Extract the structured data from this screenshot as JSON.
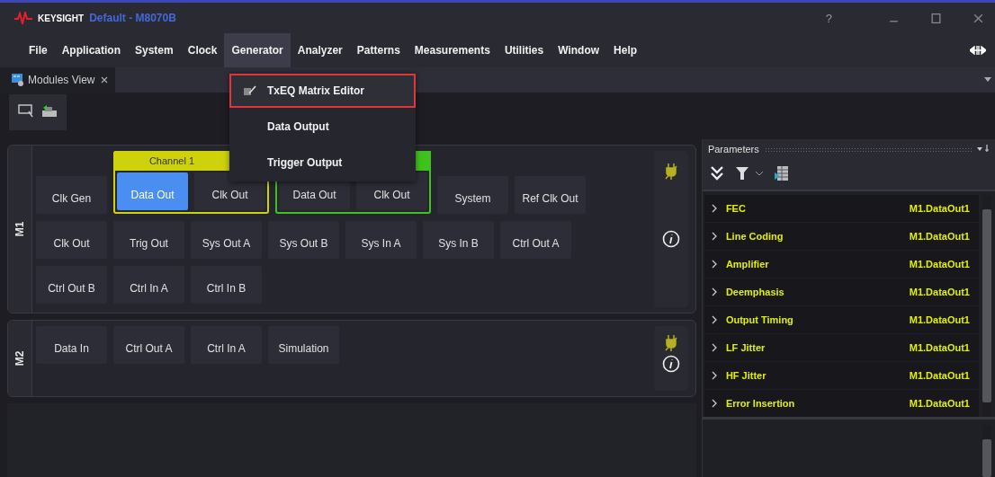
{
  "title_bar": {
    "brand": "KEYSIGHT",
    "document": "Default - M8070B",
    "help": "?"
  },
  "menu": [
    {
      "label": "File",
      "selected": false
    },
    {
      "label": "Application",
      "selected": false
    },
    {
      "label": "System",
      "selected": false
    },
    {
      "label": "Clock",
      "selected": false
    },
    {
      "label": "Generator",
      "selected": true
    },
    {
      "label": "Analyzer",
      "selected": false
    },
    {
      "label": "Patterns",
      "selected": false
    },
    {
      "label": "Measurements",
      "selected": false
    },
    {
      "label": "Utilities",
      "selected": false
    },
    {
      "label": "Window",
      "selected": false
    },
    {
      "label": "Help",
      "selected": false
    }
  ],
  "dropdown": [
    {
      "label": "TxEQ Matrix Editor",
      "kind": "icon",
      "highlighted": true
    },
    {
      "label": "Data Output",
      "kind": "plain",
      "highlighted": false
    },
    {
      "label": "Trigger Output",
      "kind": "plain",
      "highlighted": false
    }
  ],
  "tabs": [
    {
      "label": "Modules View",
      "selected": true
    }
  ],
  "modules": [
    {
      "label": "M1",
      "channel_groups": [
        {
          "title": "Channel 1",
          "color": "#cdd20a"
        },
        {
          "color": "#3fc21e"
        }
      ],
      "rows": [
        [
          {
            "kind": "tile",
            "label": "Clk Gen",
            "selected": false
          },
          {
            "kind": "channel",
            "label": "Data Out",
            "selected": true
          },
          {
            "kind": "channel",
            "label": "Clk Out",
            "selected": false
          },
          {
            "kind": "channel",
            "label": "Data Out",
            "selected": false
          },
          {
            "kind": "channel",
            "label": "Clk Out",
            "selected": false
          },
          {
            "kind": "tile",
            "label": "System",
            "selected": false
          },
          {
            "kind": "tile",
            "label": "Ref Clk Out",
            "selected": false
          }
        ],
        [
          {
            "kind": "tile",
            "label": "Clk Out",
            "selected": false
          },
          {
            "kind": "tile",
            "label": "Trig Out",
            "selected": false
          },
          {
            "kind": "tile",
            "label": "Sys Out A",
            "selected": false
          },
          {
            "kind": "tile",
            "label": "Sys Out B",
            "selected": false
          },
          {
            "kind": "tile",
            "label": "Sys In A",
            "selected": false
          },
          {
            "kind": "tile",
            "label": "Sys In B",
            "selected": false
          },
          {
            "kind": "tile",
            "label": "Ctrl Out A",
            "selected": false
          }
        ],
        [
          {
            "kind": "tile",
            "label": "Ctrl Out B",
            "selected": false
          },
          {
            "kind": "tile",
            "label": "Ctrl In A",
            "selected": false
          },
          {
            "kind": "tile",
            "label": "Ctrl In B",
            "selected": false
          }
        ]
      ]
    },
    {
      "label": "M2",
      "rows": [
        [
          {
            "kind": "tile",
            "label": "Data In",
            "selected": false
          },
          {
            "kind": "tile",
            "label": "Ctrl Out A",
            "selected": false
          },
          {
            "kind": "tile",
            "label": "Ctrl In A",
            "selected": false
          },
          {
            "kind": "tile",
            "label": "Simulation",
            "selected": false
          }
        ]
      ]
    }
  ],
  "parameters": {
    "title": "Parameters",
    "rows": [
      {
        "name": "FEC",
        "value": "M1.DataOut1"
      },
      {
        "name": "Line Coding",
        "value": "M1.DataOut1"
      },
      {
        "name": "Amplifier",
        "value": "M1.DataOut1"
      },
      {
        "name": "Deemphasis",
        "value": "M1.DataOut1"
      },
      {
        "name": "Output Timing",
        "value": "M1.DataOut1"
      },
      {
        "name": "LF Jitter",
        "value": "M1.DataOut1"
      },
      {
        "name": "HF Jitter",
        "value": "M1.DataOut1"
      },
      {
        "name": "Error Insertion",
        "value": "M1.DataOut1"
      }
    ]
  }
}
